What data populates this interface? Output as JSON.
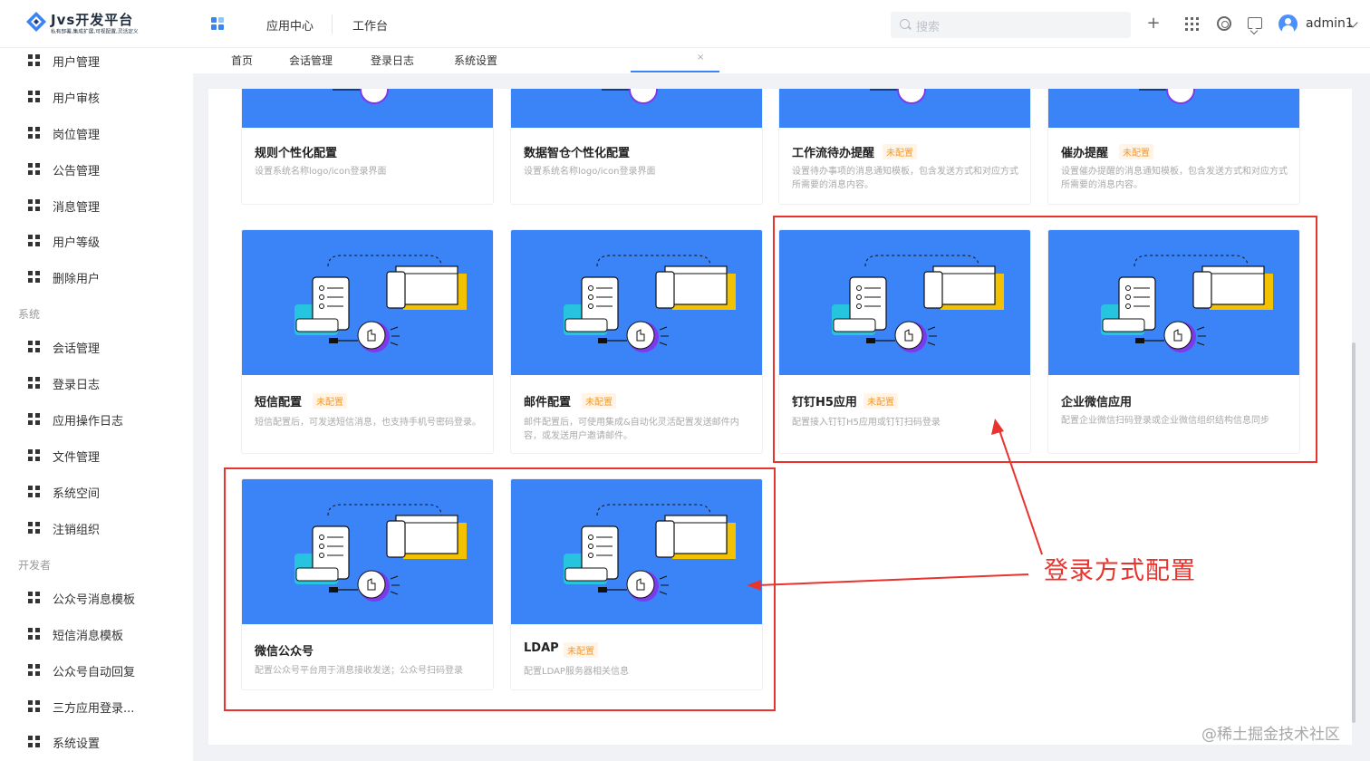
{
  "app": {
    "title": "Jvs开发平台",
    "subtitle": "私有部署,集成扩展,可视配置,灵活定义",
    "nav": [
      "应用中心",
      "工作台"
    ],
    "search_placeholder": "搜索",
    "username": "admin1"
  },
  "sidebar": {
    "items_top": [
      "用户管理",
      "用户审核",
      "岗位管理",
      "公告管理",
      "消息管理",
      "用户等级",
      "删除用户"
    ],
    "group_system": "系统",
    "items_system": [
      "会话管理",
      "登录日志",
      "应用操作日志",
      "文件管理",
      "系统空间",
      "注销组织"
    ],
    "group_dev": "开发者",
    "items_dev": [
      "公众号消息模板",
      "短信消息模板",
      "公众号自动回复",
      "三方应用登录...",
      "系统设置"
    ]
  },
  "tabs": [
    "首页",
    "会话管理",
    "登录日志",
    "系统设置"
  ],
  "tab_close": "×",
  "cards": [
    {
      "title": "规则个性化配置",
      "badge": "",
      "desc": "设置系统名称logo/icon登录界面"
    },
    {
      "title": "数据智仓个性化配置",
      "badge": "",
      "desc": "设置系统名称logo/icon登录界面"
    },
    {
      "title": "工作流待办提醒",
      "badge": "未配置",
      "desc": "设置待办事项的消息通知模板，包含发送方式和对应方式所需要的消息内容。"
    },
    {
      "title": "催办提醒",
      "badge": "未配置",
      "desc": "设置催办提醒的消息通知模板，包含发送方式和对应方式所需要的消息内容。"
    },
    {
      "title": "短信配置",
      "badge": "未配置",
      "desc": "短信配置后，可发送短信消息，也支持手机号密码登录。"
    },
    {
      "title": "邮件配置",
      "badge": "未配置",
      "desc": "邮件配置后，可使用集成&自动化灵活配置发送邮件内容，或发送用户邀请邮件。"
    },
    {
      "title": "钉钉H5应用",
      "badge": "未配置",
      "desc": "配置接入钉钉H5应用或钉钉扫码登录"
    },
    {
      "title": "企业微信应用",
      "badge": "",
      "desc": "配置企业微信扫码登录或企业微信组织结构信息同步"
    },
    {
      "title": "微信公众号",
      "badge": "",
      "desc": "配置公众号平台用于消息接收发送；公众号扫码登录"
    },
    {
      "title": "LDAP",
      "badge": "未配置",
      "desc": "配置LDAP服务器相关信息"
    }
  ],
  "annotation": "登录方式配置",
  "watermark": "@稀土掘金技术社区",
  "bg_watermark": "admin1",
  "colors": {
    "accent": "#3a84f7",
    "annotation": "#e8342e",
    "badge": "#f29a2e"
  }
}
